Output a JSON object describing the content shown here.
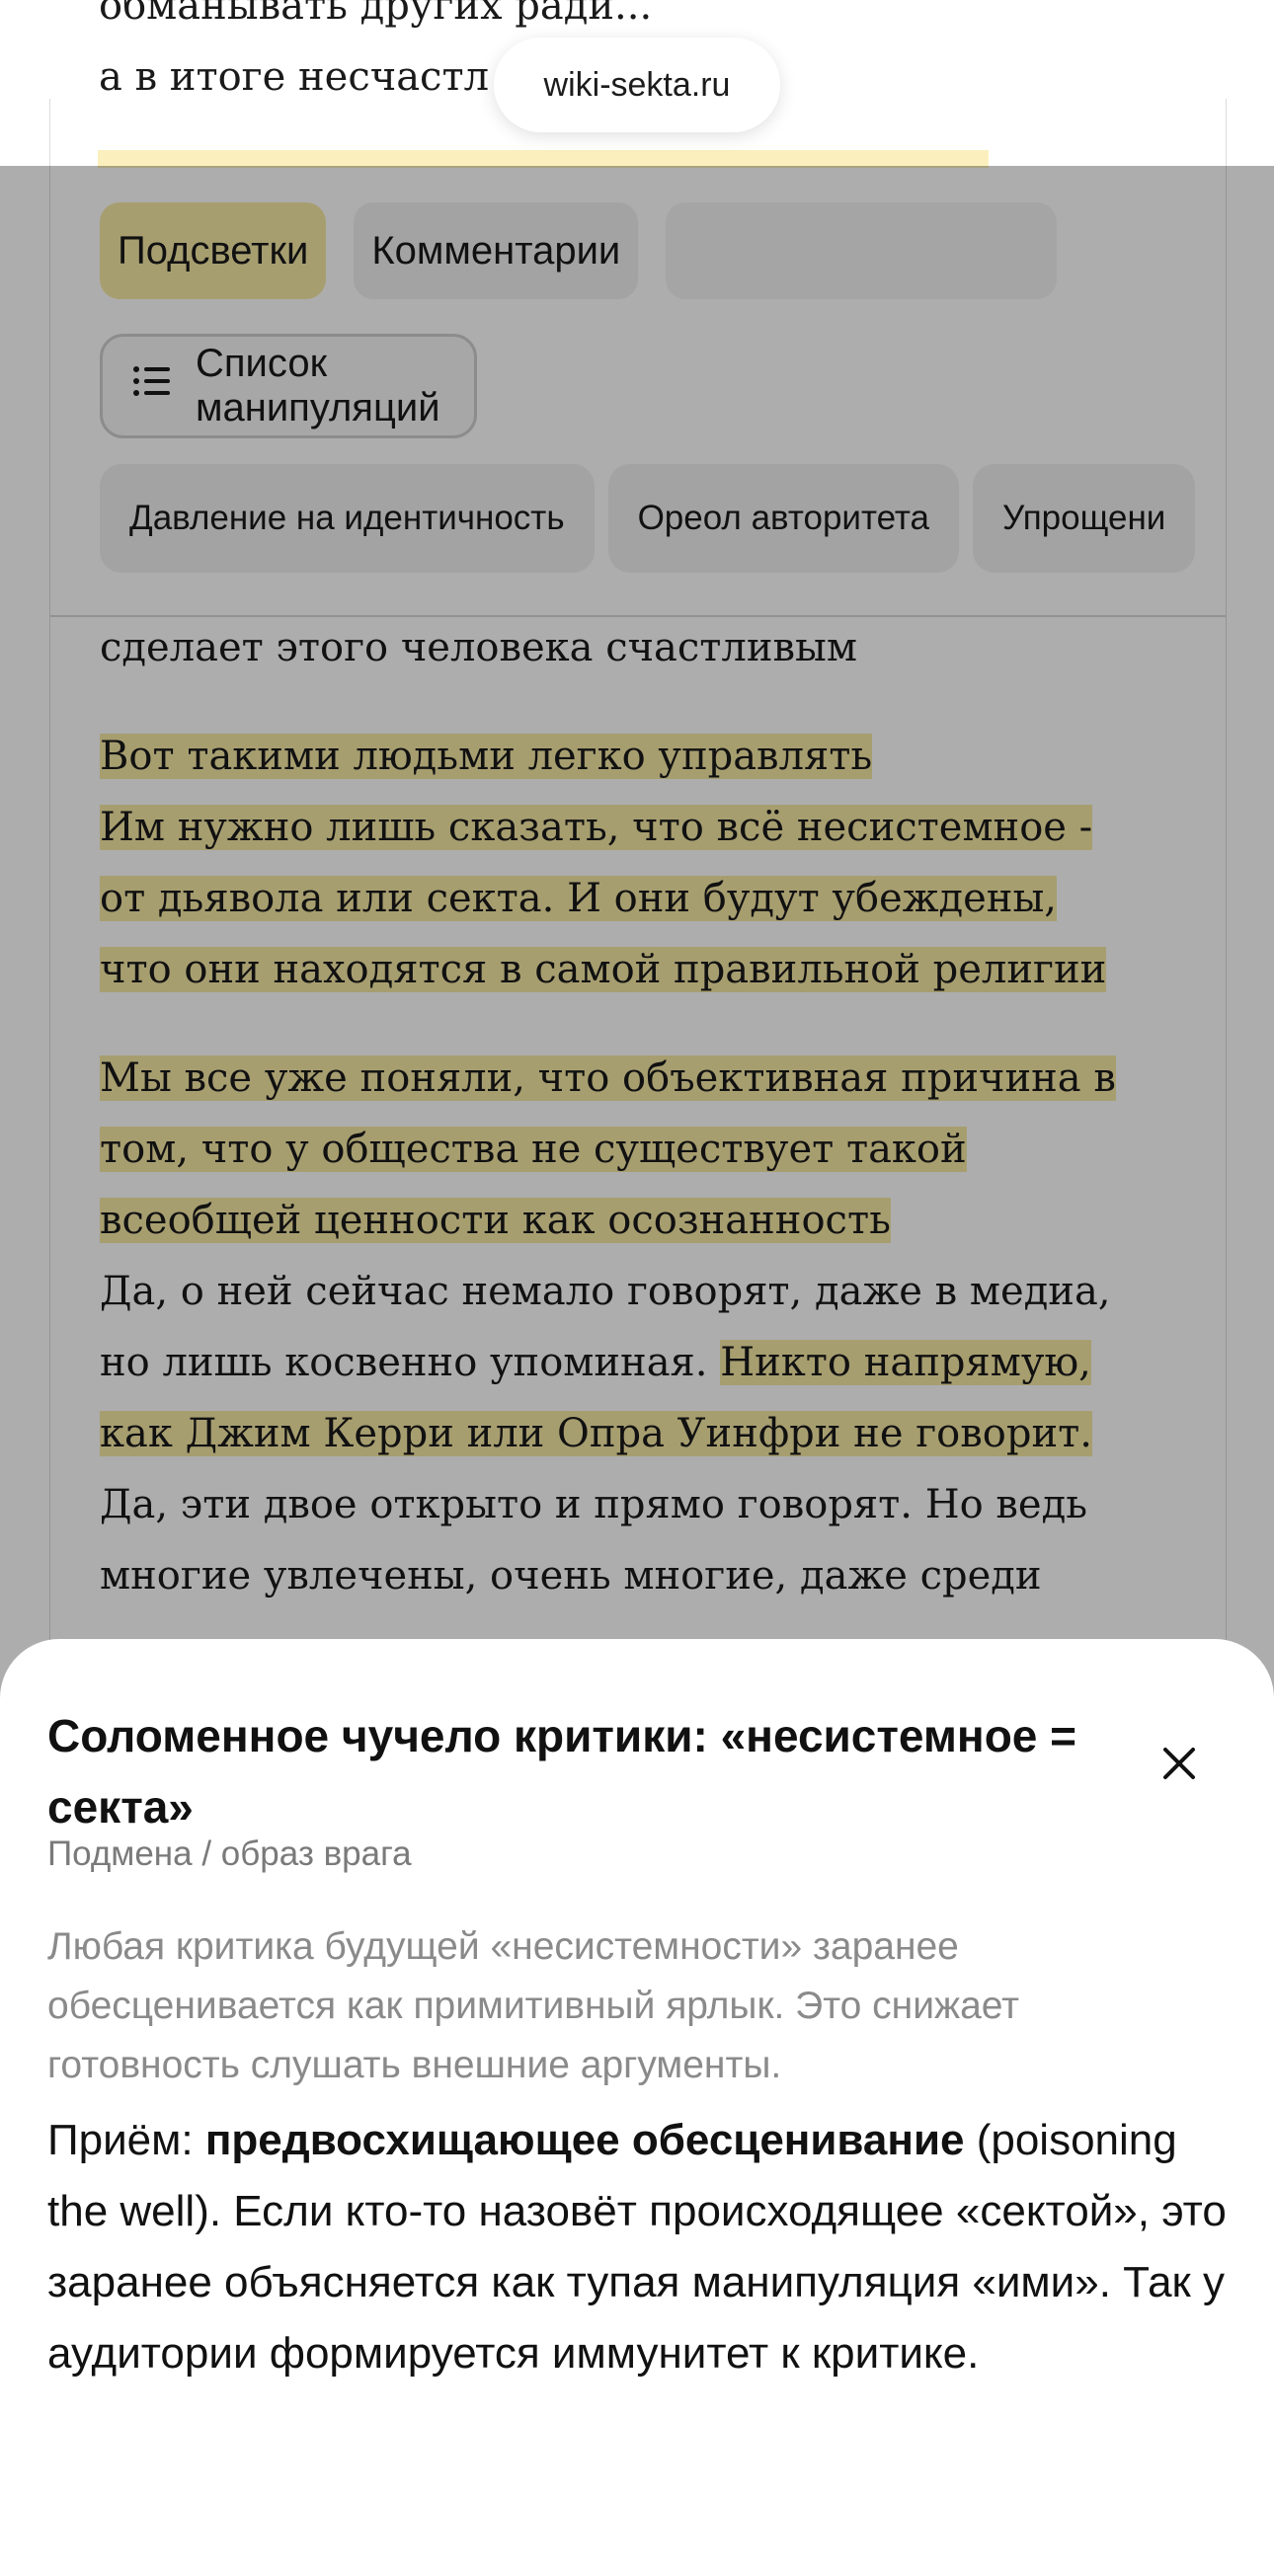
{
  "browser": {
    "url": "wiki-sekta.ru"
  },
  "article_top": {
    "line1": "обманывать других ради...",
    "line2": "а в итоге несчастл"
  },
  "toolbar": {
    "tab_highlights": "Подсветки",
    "tab_comments": "Комментарии",
    "list_button": "Список манипуляций",
    "chips": [
      "Давление на идентичность",
      "Ореол авторитета",
      "Упрощени"
    ]
  },
  "article": {
    "p1": "сделает этого человека счастливым",
    "p2_l1": "Вот такими людьми легко управлять",
    "p2_l2": "Им нужно лишь сказать, что всё несистемное -",
    "p2_l3": "от дьявола или секта. И они будут убеждены,",
    "p2_l4": "что они находятся в самой правильной религии",
    "p3_l1": "Мы все уже поняли, что объективная причина в",
    "p3_l2": "том, что у общества не существует такой",
    "p3_l3": "всеобщей ценности как осознанность",
    "p3_l4": "Да, о ней сейчас немало говорят, даже в медиа,",
    "p3_l5a": "но лишь косвенно упоминая.",
    "p3_l5b": "Никто напрямую,",
    "p3_l6": "как Джим Керри или Опра Уинфри не говорит.",
    "p3_l7": "Да, эти двое открыто и прямо говорят. Но ведь",
    "p3_l8": "многие увлечены, очень многие, даже среди"
  },
  "sheet": {
    "title": "Соломенное чучело критики: «несистемное = секта»",
    "subtitle": "Подмена / образ врага",
    "description": "Любая критика будущей «несистемности» заранее обесценивается как примитивный ярлык. Это снижает готовность слушать внешние аргументы.",
    "body_prefix": "Приём: ",
    "body_bold": "предвосхищающее обесценивание",
    "body_rest": " (poisoning the well). Если кто-то назовёт происходящее «сектой», это заранее объясняется как тупая манипуляция «ими». Так у аудитории формируется иммунитет к критике.",
    "close_icon": "close-icon"
  },
  "colors": {
    "highlight": "#f7e9a6",
    "overlay": "rgba(0,0,0,0.32)",
    "muted_text": "#8a8a8a"
  }
}
